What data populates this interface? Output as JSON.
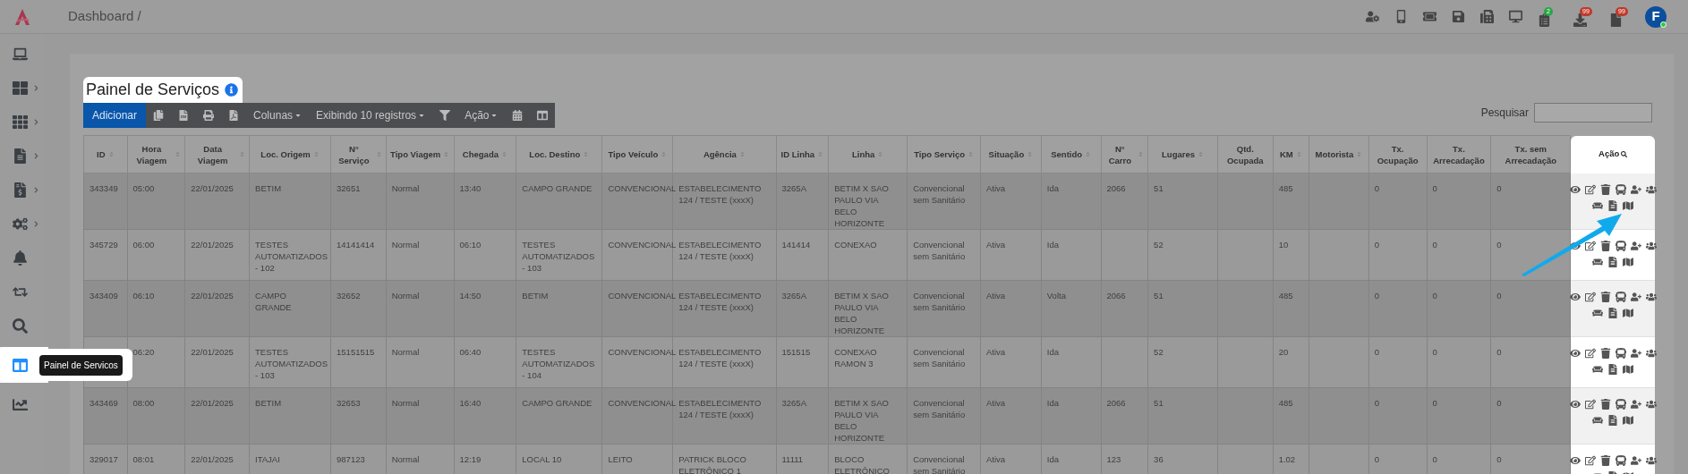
{
  "header": {
    "breadcrumb": "Dashboard /",
    "badges": [
      {
        "count": "2",
        "color": "#28a745"
      },
      {
        "count": "99",
        "color": "#c0392b"
      },
      {
        "count": "99",
        "color": "#c0392b"
      }
    ],
    "avatar": "F"
  },
  "sidebar": {
    "items": [
      {
        "expandable": false,
        "selected": false
      },
      {
        "expandable": true,
        "selected": false
      },
      {
        "expandable": true,
        "selected": false
      },
      {
        "expandable": true,
        "selected": false
      },
      {
        "expandable": true,
        "selected": false
      },
      {
        "expandable": true,
        "selected": false
      },
      {
        "expandable": false,
        "selected": false
      },
      {
        "expandable": false,
        "selected": false
      },
      {
        "expandable": false,
        "selected": false
      },
      {
        "expandable": false,
        "selected": true,
        "tooltip": "Painel de Servicos"
      },
      {
        "expandable": false,
        "selected": false
      }
    ]
  },
  "page": {
    "title": "Painel de Serviços"
  },
  "toolbar": [
    {
      "kind": "primary",
      "label": "Adicionar"
    },
    {
      "kind": "icon"
    },
    {
      "kind": "icon"
    },
    {
      "kind": "icon"
    },
    {
      "kind": "icon"
    },
    {
      "kind": "dropdown",
      "label": "Colunas"
    },
    {
      "kind": "dropdown",
      "label": "Exibindo 10 registros"
    },
    {
      "kind": "icon"
    },
    {
      "kind": "dropdown",
      "label": "Ação"
    },
    {
      "kind": "icon"
    },
    {
      "kind": "icon"
    }
  ],
  "search": {
    "label": "Pesquisar"
  },
  "table": {
    "columns": [
      {
        "label": "ID",
        "sortable": true
      },
      {
        "label": "Hora Viagem",
        "sortable": true
      },
      {
        "label": "Data Viagem",
        "sortable": true
      },
      {
        "label": "Loc. Origem",
        "sortable": true
      },
      {
        "label": "N° Serviço",
        "sortable": true
      },
      {
        "label": "Tipo Viagem",
        "sortable": true
      },
      {
        "label": "Chegada",
        "sortable": true
      },
      {
        "label": "Loc. Destino",
        "sortable": true
      },
      {
        "label": "Tipo Veículo",
        "sortable": true
      },
      {
        "label": "Agência",
        "sortable": true
      },
      {
        "label": "ID Linha",
        "sortable": true
      },
      {
        "label": "Linha",
        "sortable": true
      },
      {
        "label": "Tipo Serviço",
        "sortable": true
      },
      {
        "label": "Situação",
        "sortable": true
      },
      {
        "label": "Sentido",
        "sortable": true
      },
      {
        "label": "N° Carro",
        "sortable": true
      },
      {
        "label": "Lugares",
        "sortable": true
      },
      {
        "label": "Qtd. Ocupada",
        "sortable": false
      },
      {
        "label": "KM",
        "sortable": true
      },
      {
        "label": "Motorista",
        "sortable": true
      },
      {
        "label": "Tx. Ocupação",
        "sortable": false
      },
      {
        "label": "Tx. Arrecadação",
        "sortable": false
      },
      {
        "label": "Tx. sem Arrecadação",
        "sortable": false
      }
    ],
    "action_column": "Ação",
    "rows": [
      {
        "cells": [
          "343349",
          "05:00",
          "22/01/2025",
          "BETIM",
          "32651",
          "Normal",
          "13:40",
          "CAMPO GRANDE",
          "CONVENCIONAL",
          "ESTABELECIMENTO 124 / TESTE (xxxX)",
          "3265A",
          "BETIM X SAO PAULO VIA BELO HORIZONTE",
          "Convencional sem Sanitário",
          "Ativa",
          "Ida",
          "2066",
          "51",
          "",
          "485",
          "",
          "0",
          "0",
          "0"
        ]
      },
      {
        "cells": [
          "345729",
          "06:00",
          "22/01/2025",
          "TESTES AUTOMATIZADOS - 102",
          "14141414",
          "Normal",
          "06:10",
          "TESTES AUTOMATIZADOS - 103",
          "CONVENCIONAL",
          "ESTABELECIMENTO 124 / TESTE (xxxX)",
          "141414",
          "CONEXAO",
          "Convencional sem Sanitário",
          "Ativa",
          "Ida",
          "",
          "52",
          "",
          "10",
          "",
          "0",
          "0",
          "0"
        ]
      },
      {
        "cells": [
          "343409",
          "06:10",
          "22/01/2025",
          "CAMPO GRANDE",
          "32652",
          "Normal",
          "14:50",
          "BETIM",
          "CONVENCIONAL",
          "ESTABELECIMENTO 124 / TESTE (xxxX)",
          "3265A",
          "BETIM X SAO PAULO VIA BELO HORIZONTE",
          "Convencional sem Sanitário",
          "Ativa",
          "Volta",
          "2066",
          "51",
          "",
          "485",
          "",
          "0",
          "0",
          "0"
        ]
      },
      {
        "cells": [
          "",
          "06:20",
          "22/01/2025",
          "TESTES AUTOMATIZADOS - 103",
          "15151515",
          "Normal",
          "06:40",
          "TESTES AUTOMATIZADOS - 104",
          "CONVENCIONAL",
          "ESTABELECIMENTO 124 / TESTE (xxxX)",
          "151515",
          "CONEXAO RAMON 3",
          "Convencional sem Sanitário",
          "Ativa",
          "Ida",
          "",
          "52",
          "",
          "20",
          "",
          "0",
          "0",
          "0"
        ]
      },
      {
        "cells": [
          "343469",
          "08:00",
          "22/01/2025",
          "BETIM",
          "32653",
          "Normal",
          "16:40",
          "CAMPO GRANDE",
          "CONVENCIONAL",
          "ESTABELECIMENTO 124 / TESTE (xxxX)",
          "3265A",
          "BETIM X SAO PAULO VIA BELO HORIZONTE",
          "Convencional sem Sanitário",
          "Ativa",
          "Ida",
          "2066",
          "51",
          "",
          "485",
          "",
          "0",
          "0",
          "0"
        ]
      },
      {
        "cells": [
          "329017",
          "08:01",
          "22/01/2025",
          "ITAJAI",
          "987123",
          "Normal",
          "12:19",
          "LOCAL 10",
          "LEITO",
          "PATRICK BLOCO ELETRÔNICO 1",
          "11111",
          "BLOCO ELETRÔNICO",
          "Convencional sem Sanitário",
          "Ativa",
          "Ida",
          "123",
          "36",
          "",
          "1.02",
          "",
          "0",
          "0",
          "0"
        ]
      }
    ]
  }
}
